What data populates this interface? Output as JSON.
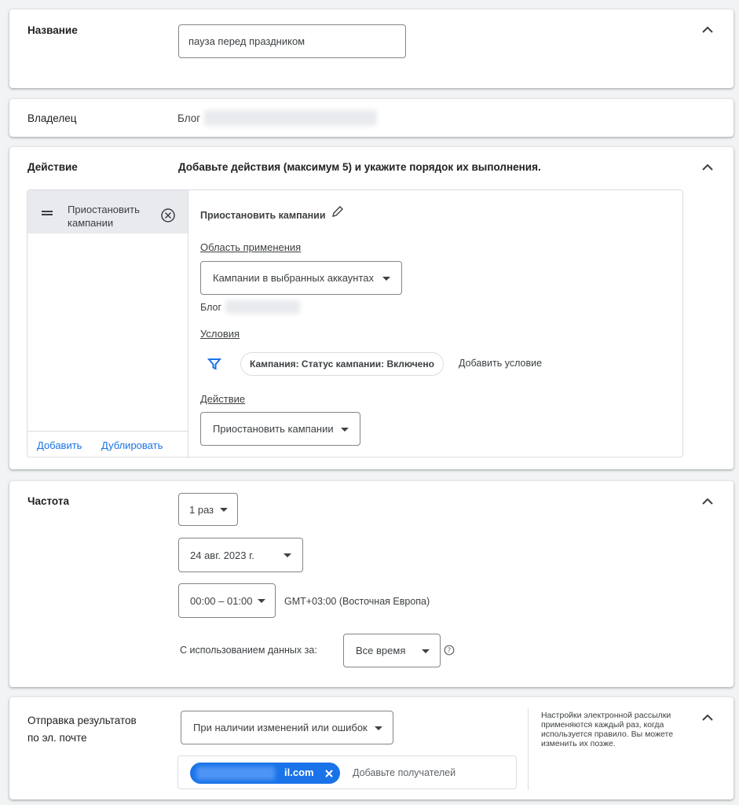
{
  "name_section": {
    "label": "Название",
    "value": "пауза перед праздником"
  },
  "owner_section": {
    "label": "Владелец",
    "value_prefix": "Блог"
  },
  "action_section": {
    "label": "Действие",
    "description": "Добавьте действия (максимум 5) и укажите порядок их выполнения.",
    "actions_list": [
      {
        "label": "Приостановить кампании"
      }
    ],
    "add_label": "Добавить",
    "duplicate_label": "Дублировать",
    "detail": {
      "title": "Приостановить кампании",
      "scope_label": "Область применения",
      "scope_value": "Кампании в выбранных аккаунтах",
      "account_prefix": "Блог",
      "conditions_label": "Условия",
      "condition_chip": "Кампания: Статус кампании: Включено",
      "add_condition": "Добавить условие",
      "action_label": "Действие",
      "action_value": "Приостановить кампании"
    }
  },
  "frequency_section": {
    "label": "Частота",
    "repeat_value": "1 раз",
    "date_value": "24 авг. 2023 г.",
    "time_value": "00:00 – 01:00",
    "timezone": "GMT+03:00 (Восточная Европа)",
    "data_range_label": "С использованием данных за:",
    "data_range_value": "Все время"
  },
  "email_section": {
    "label_line1": "Отправка результатов",
    "label_line2": "по эл. почте",
    "send_value": "При наличии изменений или ошибок",
    "recipient_suffix": "il.com",
    "add_recipients": "Добавьте получателей",
    "note": "Настройки электронной рассылки применяются каждый раз, когда используется правило. Вы можете изменить их позже."
  },
  "colors": {
    "accent": "#1a73e8",
    "chip_blue": "#1a73e8",
    "selected_row": "#e8eaed"
  }
}
